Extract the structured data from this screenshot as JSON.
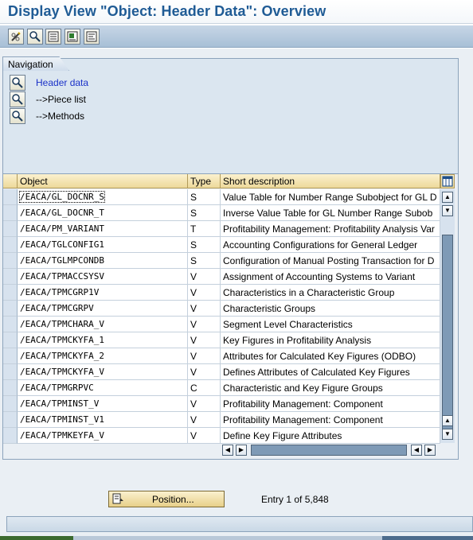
{
  "window": {
    "title": "Display View \"Object: Header Data\": Overview"
  },
  "toolbar": {
    "buttons": [
      {
        "icon": "glasses-pencil-icon"
      },
      {
        "icon": "display-detail-icon"
      },
      {
        "icon": "select-all-icon"
      },
      {
        "icon": "select-block-icon"
      },
      {
        "icon": "deselect-all-icon"
      }
    ]
  },
  "navigation": {
    "title": "Navigation",
    "items": [
      {
        "label": "Header data",
        "active": true
      },
      {
        "label": "-->Piece list",
        "active": false
      },
      {
        "label": "-->Methods",
        "active": false
      }
    ]
  },
  "table": {
    "columns": [
      "Object",
      "Type",
      "Short description"
    ],
    "rows": [
      [
        "/EACA/GL_DOCNR_S",
        "S",
        "Value Table for Number Range Subobject for GL D"
      ],
      [
        "/EACA/GL_DOCNR_T",
        "S",
        "Inverse Value Table for GL Number Range Subob"
      ],
      [
        "/EACA/PM_VARIANT",
        "T",
        "Profitability Management:  Profitability Analysis Var"
      ],
      [
        "/EACA/TGLCONFIG1",
        "S",
        "Accounting Configurations for General Ledger"
      ],
      [
        "/EACA/TGLMPCONDB",
        "S",
        "Configuration of Manual Posting Transaction for D"
      ],
      [
        "/EACA/TPMACCSYSV",
        "V",
        "Assignment of Accounting Systems to Variant"
      ],
      [
        "/EACA/TPMCGRP1V",
        "V",
        "Characteristics in a Characteristic Group"
      ],
      [
        "/EACA/TPMCGRPV",
        "V",
        "Characteristic Groups"
      ],
      [
        "/EACA/TPMCHARA_V",
        "V",
        "Segment Level Characteristics"
      ],
      [
        "/EACA/TPMCKYFA_1",
        "V",
        "Key Figures in Profitability Analysis"
      ],
      [
        "/EACA/TPMCKYFA_2",
        "V",
        "Attributes for Calculated Key Figures (ODBO)"
      ],
      [
        "/EACA/TPMCKYFA_V",
        "V",
        "Defines Attributes of Calculated Key Figures"
      ],
      [
        "/EACA/TPMGRPVC",
        "C",
        "Characteristic and Key Figure Groups"
      ],
      [
        "/EACA/TPMINST_V",
        "V",
        "Profitability Management: Component"
      ],
      [
        "/EACA/TPMINST_V1",
        "V",
        "Profitability Management: Component"
      ],
      [
        "/EACA/TPMKEYFA_V",
        "V",
        "Define Key Figure Attributes"
      ]
    ]
  },
  "footer": {
    "position_label": "Position...",
    "entry_text": "Entry 1 of 5,848"
  },
  "colors": {
    "title": "#1f5b95",
    "header_bg": "#edd99a",
    "panel_bg": "#dbe6f0",
    "link": "#1a31c8"
  }
}
